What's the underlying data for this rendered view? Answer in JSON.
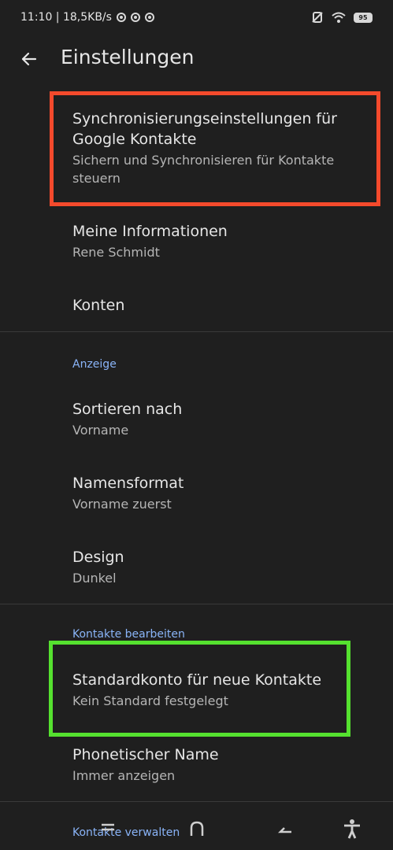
{
  "status_bar": {
    "time_speed": "11:10 | 18,5KB/s",
    "battery_level": "95",
    "icons": [
      "chrome-icon",
      "chrome-icon",
      "chrome-icon",
      "no-sim-icon",
      "wifi-icon",
      "battery-icon"
    ]
  },
  "toolbar": {
    "title": "Einstellungen",
    "back_icon": "arrow-back-icon"
  },
  "settings": {
    "sync": {
      "title": "Synchronisierungseinstellungen für Google Kontakte",
      "summary": "Sichern und Synchronisieren für Kontakte steuern"
    },
    "my_info": {
      "title": "Meine Informationen",
      "summary": "Rene Schmidt"
    },
    "accounts": {
      "title": "Konten"
    },
    "display_category": "Anzeige",
    "sort_by": {
      "title": "Sortieren nach",
      "summary": "Vorname"
    },
    "name_format": {
      "title": "Namensformat",
      "summary": "Vorname zuerst"
    },
    "design": {
      "title": "Design",
      "summary": "Dunkel"
    },
    "edit_category": "Kontakte bearbeiten",
    "default_account": {
      "title": "Standardkonto für neue Kontakte",
      "summary": "Kein Standard festgelegt"
    },
    "phonetic_name": {
      "title": "Phonetischer Name",
      "summary": "Immer anzeigen"
    },
    "manage_category": "Kontakte verwalten"
  },
  "highlight_colors": {
    "red": "#f44a2c",
    "green": "#55e12f"
  },
  "nav_bar": [
    "menu-icon",
    "home-icon",
    "back-icon",
    "accessibility-icon"
  ]
}
